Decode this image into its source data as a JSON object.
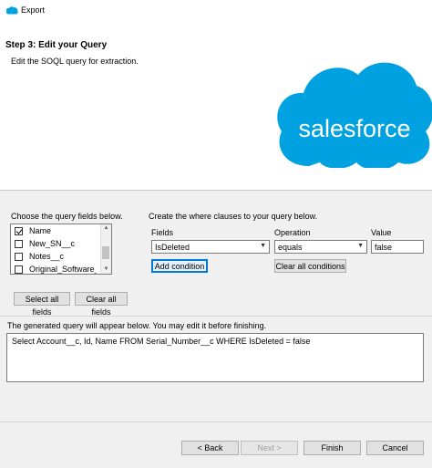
{
  "window": {
    "title": "Export"
  },
  "header": {
    "step_title": "Step 3: Edit your Query",
    "step_subtitle": "Edit the SOQL query for extraction.",
    "logo_text": "salesforce"
  },
  "fields_panel": {
    "label": "Choose the query fields below.",
    "items": [
      {
        "label": "Name",
        "checked": true
      },
      {
        "label": "New_SN__c",
        "checked": false
      },
      {
        "label": "Notes__c",
        "checked": false
      },
      {
        "label": "Original_Software_Ve",
        "checked": false
      }
    ],
    "select_all_label": "Select all fields",
    "clear_all_label": "Clear all fields"
  },
  "where_panel": {
    "label": "Create the where clauses to your query below.",
    "fields_label": "Fields",
    "operation_label": "Operation",
    "value_label": "Value",
    "field_value": "IsDeleted",
    "operation_value": "equals",
    "value_value": "false",
    "add_condition_label": "Add condition",
    "clear_conditions_label": "Clear all conditions"
  },
  "query": {
    "label": "The generated query will appear below.  You may edit it before finishing.",
    "text": "Select Account__c, Id, Name FROM Serial_Number__c WHERE IsDeleted = false"
  },
  "footer": {
    "back_label": "< Back",
    "next_label": "Next >",
    "finish_label": "Finish",
    "cancel_label": "Cancel"
  },
  "colors": {
    "brand": "#00a1e0",
    "focus": "#0078d7"
  }
}
